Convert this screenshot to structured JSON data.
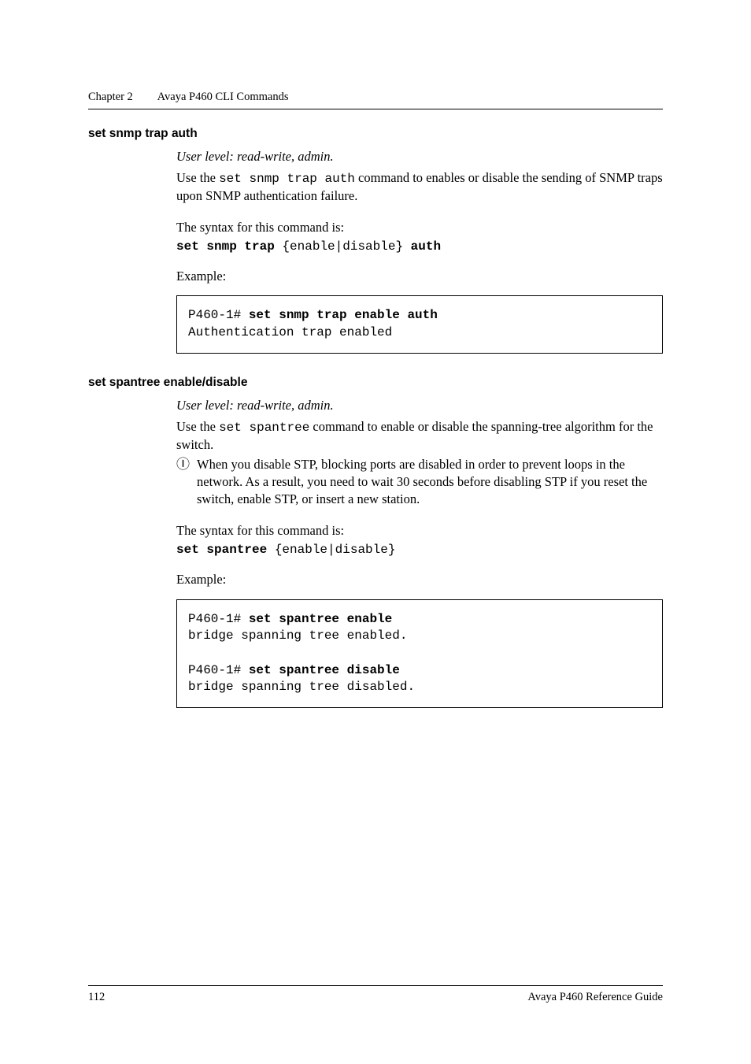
{
  "header": {
    "chapter": "Chapter 2",
    "title": "Avaya P460 CLI Commands"
  },
  "s1": {
    "heading": "set snmp trap auth",
    "user_level": "User level: read-write, admin.",
    "para1_a": "Use the ",
    "para1_cmd": "set snmp trap auth",
    "para1_b": " command to enables or disable the sending of SNMP traps upon SNMP authentication failure.",
    "syntax_intro": "The syntax for this command is:",
    "syntax_1_b1": "set snmp trap",
    "syntax_1_mid": " {enable|disable} ",
    "syntax_1_b2": "auth",
    "example_label": "Example:",
    "ex_prompt": "P460-1# ",
    "ex_cmd": "set snmp trap enable auth",
    "ex_out": "Authentication trap enabled"
  },
  "s2": {
    "heading": "set spantree enable/disable",
    "user_level": "User level: read-write, admin.",
    "para1_a": "Use the ",
    "para1_cmd": "set spantree",
    "para1_b": " command to enable or disable the spanning-tree algorithm for the switch.",
    "note_icon": "Ⓘ",
    "note": "When you disable STP, blocking ports are disabled in order to prevent loops in the network. As a result, you need to wait 30 seconds before disabling STP if you reset the switch, enable STP, or insert a new station.",
    "syntax_intro": "The syntax for this command is:",
    "syntax_b": "set spantree",
    "syntax_rest": " {enable|disable}",
    "example_label": "Example:",
    "ex1_prompt": "P460-1# ",
    "ex1_cmd": "set spantree enable",
    "ex1_out": "bridge spanning tree enabled.",
    "ex2_prompt": "P460-1# ",
    "ex2_cmd": "set spantree disable",
    "ex2_out": "bridge spanning tree disabled."
  },
  "footer": {
    "page": "112",
    "guide": "Avaya P460 Reference Guide"
  }
}
